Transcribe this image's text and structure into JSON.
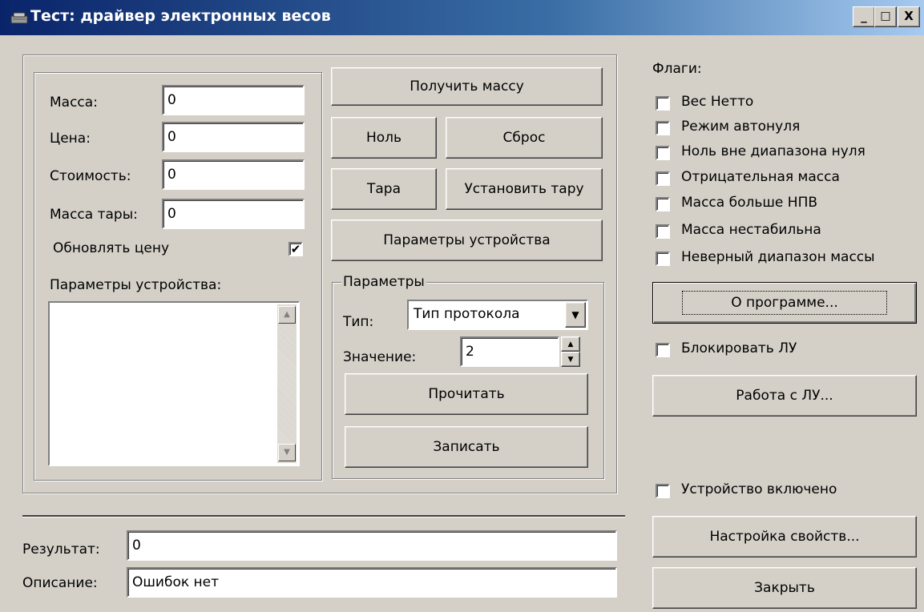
{
  "window": {
    "title": "Тест: драйвер электронных весов",
    "minimize": "_",
    "maximize": "□",
    "close": "X"
  },
  "left_panel": {
    "mass_label": "Масса:",
    "mass_value": "0",
    "price_label": "Цена:",
    "price_value": "0",
    "cost_label": "Стоимость:",
    "cost_value": "0",
    "tare_mass_label": "Масса тары:",
    "tare_mass_value": "0",
    "update_price_label": "Обновлять цену",
    "update_price_checked": "✔",
    "device_params_label": "Параметры устройства:"
  },
  "buttons": {
    "get_mass": "Получить массу",
    "zero": "Ноль",
    "reset": "Сброс",
    "tare": "Тара",
    "set_tare": "Установить тару",
    "device_params": "Параметры устройства",
    "read": "Прочитать",
    "write": "Записать",
    "about": "О программе...",
    "lu_work": "Работа с ЛУ...",
    "properties": "Настройка свойств...",
    "close": "Закрыть"
  },
  "params_group": {
    "title": "Параметры",
    "type_label": "Тип:",
    "type_value": "Тип протокола",
    "value_label": "Значение:",
    "value_value": "2"
  },
  "flags": {
    "title": "Флаги:",
    "items": [
      "Вес Нетто",
      "Режим автонуля",
      "Ноль вне диапазона нуля",
      "Отрицательная масса",
      "Масса больше НПВ",
      "Масса нестабильна",
      "Неверный диапазон массы"
    ],
    "block_lu": "Блокировать ЛУ",
    "device_enabled": "Устройство включено"
  },
  "result": {
    "result_label": "Результат:",
    "result_value": "0",
    "description_label": "Описание:",
    "description_value": "Ошибок нет"
  }
}
